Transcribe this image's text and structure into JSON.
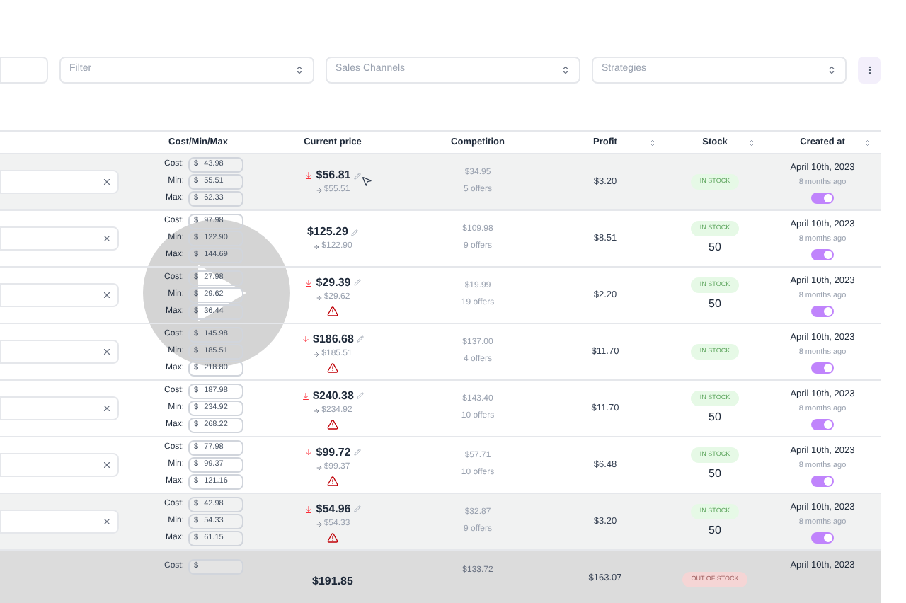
{
  "filters": [
    {
      "kind": "text"
    },
    {
      "kind": "select",
      "placeholder": "Filter"
    },
    {
      "kind": "select",
      "placeholder": "Sales Channels"
    },
    {
      "kind": "select",
      "placeholder": "Strategies"
    }
  ],
  "table": {
    "columns": [
      {
        "kind": "plain"
      },
      {
        "kind": "plain",
        "label": "Cost/Min/Max"
      },
      {
        "kind": "plain",
        "label": "Current price"
      },
      {
        "kind": "plain",
        "label": "Competition"
      },
      {
        "kind": "sortable",
        "label": "Profit"
      },
      {
        "kind": "sortable",
        "label": "Stock"
      },
      {
        "kind": "sortable",
        "label": "Created at"
      }
    ],
    "rows": [
      {
        "highlighted": true,
        "costs": [
          {
            "label": "Cost:",
            "currency": "$",
            "value": "43.98"
          },
          {
            "label": "Min:",
            "currency": "$",
            "value": "55.51"
          },
          {
            "label": "Max:",
            "currency": "$",
            "value": "62.33"
          }
        ],
        "price": "$56.81",
        "price_down": true,
        "target": "$55.51",
        "warning": false,
        "competition": "$34.95",
        "offers": "5 offers",
        "profit": "$3.20",
        "stock": "IN STOCK",
        "in_stock": true,
        "date": "April 10th, 2023",
        "ago": "8 months ago",
        "on": true
      },
      {
        "highlighted": false,
        "costs": [
          {
            "label": "Cost:",
            "currency": "$",
            "value": "97.98"
          },
          {
            "label": "Min:",
            "currency": "$",
            "value": "122.90"
          },
          {
            "label": "Max:",
            "currency": "$",
            "value": "144.69"
          }
        ],
        "price": "$125.29",
        "price_down": false,
        "target": "$122.90",
        "warning": false,
        "competition": "$109.98",
        "offers": "9 offers",
        "profit": "$8.51",
        "stock": "IN STOCK",
        "in_stock": true,
        "quantity": "50",
        "date": "April 10th, 2023",
        "ago": "8 months ago",
        "on": true
      },
      {
        "highlighted": false,
        "costs": [
          {
            "label": "Cost:",
            "currency": "$",
            "value": "27.98"
          },
          {
            "label": "Min:",
            "currency": "$",
            "value": "29.62"
          },
          {
            "label": "Max:",
            "currency": "$",
            "value": "36.44"
          }
        ],
        "price": "$29.39",
        "price_down": true,
        "target": "$29.62",
        "warning": true,
        "competition": "$19.99",
        "offers": "19 offers",
        "profit": "$2.20",
        "stock": "IN STOCK",
        "in_stock": true,
        "quantity": "50",
        "date": "April 10th, 2023",
        "ago": "8 months ago",
        "on": true
      },
      {
        "highlighted": false,
        "costs": [
          {
            "label": "Cost:",
            "currency": "$",
            "value": "145.98"
          },
          {
            "label": "Min:",
            "currency": "$",
            "value": "185.51"
          },
          {
            "label": "Max:",
            "currency": "$",
            "value": "218.80"
          }
        ],
        "price": "$186.68",
        "price_down": true,
        "target": "$185.51",
        "warning": true,
        "competition": "$137.00",
        "offers": "4 offers",
        "profit": "$11.70",
        "stock": "IN STOCK",
        "in_stock": true,
        "date": "April 10th, 2023",
        "ago": "8 months ago",
        "on": true
      },
      {
        "highlighted": false,
        "costs": [
          {
            "label": "Cost:",
            "currency": "$",
            "value": "187.98"
          },
          {
            "label": "Min:",
            "currency": "$",
            "value": "234.92"
          },
          {
            "label": "Max:",
            "currency": "$",
            "value": "268.22"
          }
        ],
        "price": "$240.38",
        "price_down": true,
        "target": "$234.92",
        "warning": true,
        "competition": "$143.40",
        "offers": "10 offers",
        "profit": "$11.70",
        "stock": "IN STOCK",
        "in_stock": true,
        "quantity": "50",
        "date": "April 10th, 2023",
        "ago": "8 months ago",
        "on": true
      },
      {
        "highlighted": false,
        "costs": [
          {
            "label": "Cost:",
            "currency": "$",
            "value": "77.98"
          },
          {
            "label": "Min:",
            "currency": "$",
            "value": "99.37"
          },
          {
            "label": "Max:",
            "currency": "$",
            "value": "121.16"
          }
        ],
        "price": "$99.72",
        "price_down": true,
        "target": "$99.37",
        "warning": true,
        "competition": "$57.71",
        "offers": "10 offers",
        "profit": "$6.48",
        "stock": "IN STOCK",
        "in_stock": true,
        "quantity": "50",
        "date": "April 10th, 2023",
        "ago": "8 months ago",
        "on": true
      },
      {
        "highlighted": true,
        "costs": [
          {
            "label": "Cost:",
            "currency": "$",
            "value": "42.98"
          },
          {
            "label": "Min:",
            "currency": "$",
            "value": "54.33"
          },
          {
            "label": "Max:",
            "currency": "$",
            "value": "61.15"
          }
        ],
        "price": "$54.96",
        "price_down": true,
        "target": "$54.33",
        "warning": true,
        "competition": "$32.87",
        "offers": "9 offers",
        "profit": "$3.20",
        "stock": "IN STOCK",
        "in_stock": true,
        "quantity": "50",
        "date": "April 10th, 2023",
        "ago": "8 months ago",
        "on": true
      }
    ],
    "partial_row": {
      "cost_label": "Cost:",
      "currency": "$",
      "price": "$191.85",
      "competition": "$133.72",
      "profit": "$163.07",
      "stock": "OUT OF STOCK",
      "in_stock": false,
      "date": "April 10th, 2023"
    }
  },
  "video": {
    "paused": true
  }
}
